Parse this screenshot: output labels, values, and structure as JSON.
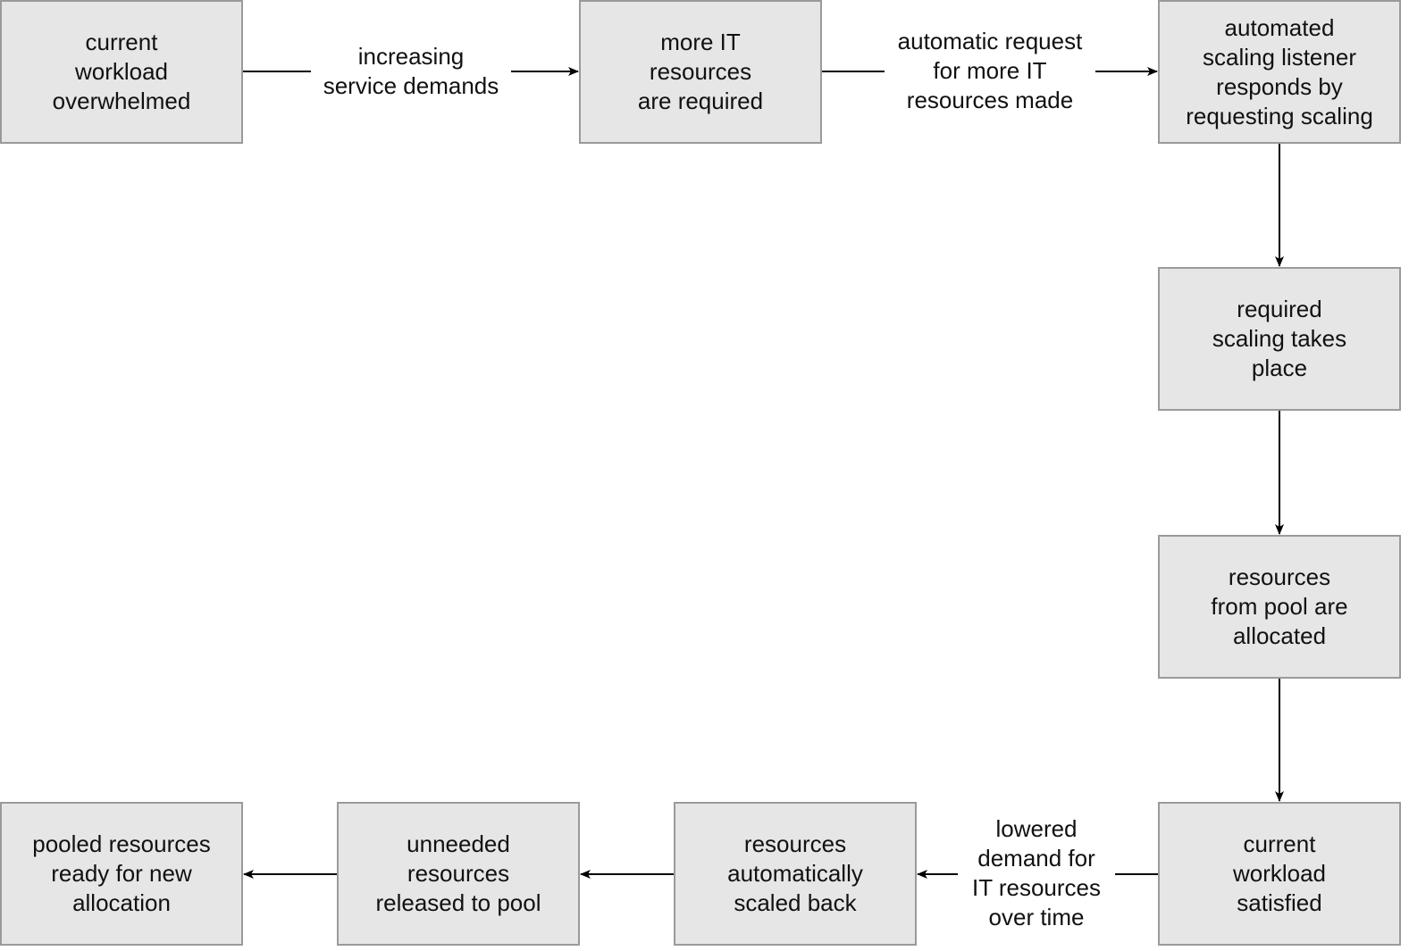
{
  "diagram": {
    "nodes": [
      {
        "id": "n1",
        "text": "current\nworkload\noverwhelmed"
      },
      {
        "id": "n2",
        "text": "more IT\nresources\nare required"
      },
      {
        "id": "n3",
        "text": "automated\nscaling listener\nresponds by\nrequesting scaling"
      },
      {
        "id": "n4",
        "text": "required\nscaling takes\nplace"
      },
      {
        "id": "n5",
        "text": "resources\nfrom pool are\nallocated"
      },
      {
        "id": "n6",
        "text": "current\nworkload\nsatisfied"
      },
      {
        "id": "n7",
        "text": "resources\nautomatically\nscaled back"
      },
      {
        "id": "n8",
        "text": "unneeded\nresources\nreleased to pool"
      },
      {
        "id": "n9",
        "text": "pooled resources\nready for new\nallocation"
      }
    ],
    "edges": [
      {
        "from": "n1",
        "to": "n2",
        "label": "increasing\nservice demands"
      },
      {
        "from": "n2",
        "to": "n3",
        "label": "automatic request\nfor more IT\nresources made"
      },
      {
        "from": "n3",
        "to": "n4",
        "label": ""
      },
      {
        "from": "n4",
        "to": "n5",
        "label": ""
      },
      {
        "from": "n5",
        "to": "n6",
        "label": ""
      },
      {
        "from": "n6",
        "to": "n7",
        "label": "lowered\ndemand for\nIT resources\nover time"
      },
      {
        "from": "n7",
        "to": "n8",
        "label": ""
      },
      {
        "from": "n8",
        "to": "n9",
        "label": ""
      }
    ]
  }
}
